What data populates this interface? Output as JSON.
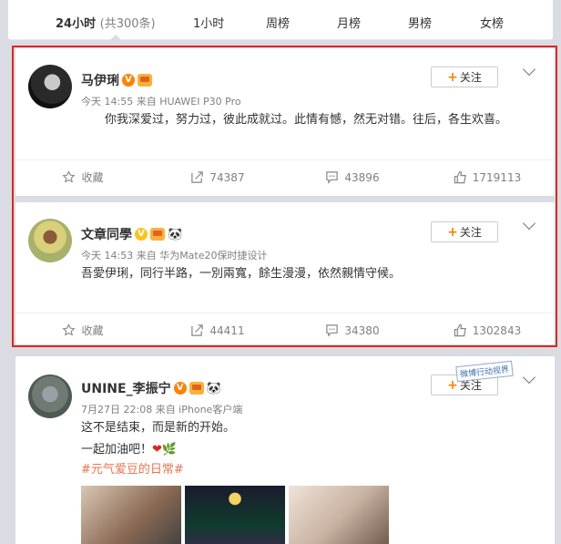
{
  "tabs": {
    "active_label": "24小时",
    "active_count": "(共300条)",
    "items": [
      "1小时",
      "周榜",
      "月榜",
      "男榜",
      "女榜"
    ]
  },
  "posts": [
    {
      "user": "马伊琍",
      "meta": "今天 14:55 来自 HUAWEI P30 Pro",
      "text": "你我深爱过，努力过，彼此成就过。此情有憾，然无对错。往后，各生欢喜。",
      "follow_label": "关注",
      "actions": {
        "fav": "收藏",
        "share": "74387",
        "comment": "43896",
        "like": "1719113"
      }
    },
    {
      "user": "文章同學",
      "meta": "今天 14:53 来自 华为Mate20保时捷设计",
      "text": "吾愛伊琍，同行半路，一別兩寬，餘生漫漫，依然親情守候。",
      "follow_label": "关注",
      "actions": {
        "fav": "收藏",
        "share": "44411",
        "comment": "34380",
        "like": "1302843"
      }
    },
    {
      "user": "UNINE_李振宁",
      "meta": "7月27日 22:08 来自 iPhone客户端",
      "line1": "这不是结束，而是新的开始。",
      "line2": "一起加油吧！",
      "hashtag": "#元气爱豆的日常#",
      "follow_label": "关注",
      "stamp": "微博行动视界"
    }
  ],
  "colors": {
    "accent": "#ff8200",
    "highlight_border": "#e0251b",
    "hashtag": "#eb7350",
    "background": "#d9dde3"
  },
  "icons": [
    "star-icon",
    "share-icon",
    "comment-icon",
    "like-icon",
    "chevron-down-icon",
    "verified-badge-icon",
    "crown-icon",
    "panda-icon"
  ]
}
